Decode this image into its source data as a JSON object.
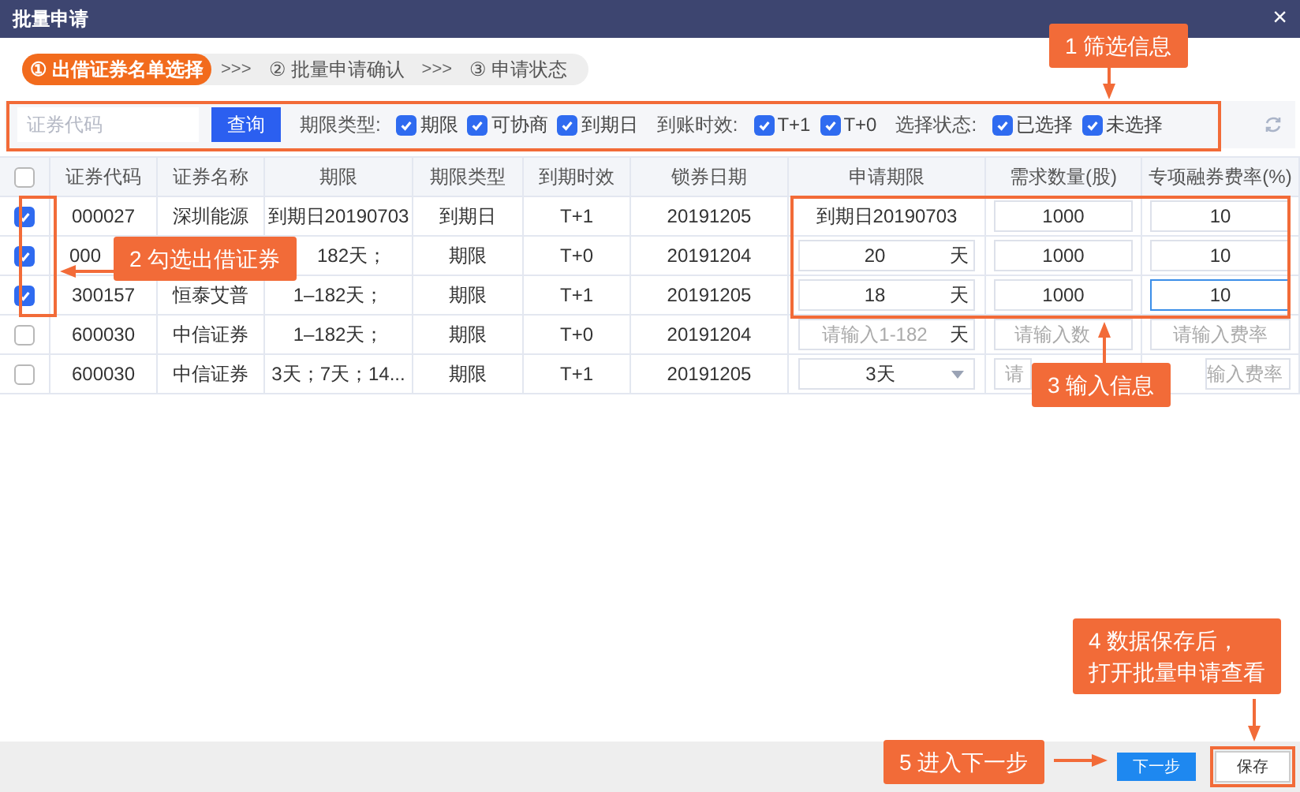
{
  "window": {
    "title": "批量申请",
    "close": "×"
  },
  "steps": [
    {
      "number": "①",
      "label": "出借证券名单选择",
      "selected": true
    },
    {
      "number": "②",
      "label": "批量申请确认",
      "selected": false
    },
    {
      "number": "③",
      "label": "申请状态",
      "selected": false
    }
  ],
  "step_separator": ">>>",
  "filter": {
    "placeholder": "证券代码",
    "query_button": "查询",
    "groups": [
      {
        "label": "期限类型:",
        "options": [
          {
            "label": "期限",
            "checked": true
          },
          {
            "label": "可协商",
            "checked": true
          },
          {
            "label": "到期日",
            "checked": true
          }
        ]
      },
      {
        "label": "到账时效:",
        "options": [
          {
            "label": "T+1",
            "checked": true
          },
          {
            "label": "T+0",
            "checked": true
          }
        ]
      },
      {
        "label": "选择状态:",
        "options": [
          {
            "label": "已选择",
            "checked": true
          },
          {
            "label": "未选择",
            "checked": true
          }
        ]
      }
    ]
  },
  "table": {
    "select_all": false,
    "columns": [
      "证券代码",
      "证券名称",
      "期限",
      "期限类型",
      "到期时效",
      "锁券日期",
      "申请期限",
      "需求数量(股)",
      "专项融券费率(%)"
    ],
    "rows": [
      {
        "checked": true,
        "code": "000027",
        "name": "深圳能源",
        "period": "到期日20190703",
        "period_type": "到期日",
        "effect": "T+1",
        "lock_date": "20191205",
        "apply": {
          "kind": "text",
          "value": "到期日20190703"
        },
        "quantity": {
          "value": "1000"
        },
        "rate": {
          "value": "10",
          "focused": false
        }
      },
      {
        "checked": true,
        "code": "000",
        "period": "182天；",
        "period_type": "期限",
        "effect": "T+0",
        "lock_date": "20191204",
        "apply": {
          "kind": "days",
          "value": "20",
          "unit": "天"
        },
        "quantity": {
          "value": "1000"
        },
        "rate": {
          "value": "10",
          "focused": false
        }
      },
      {
        "checked": true,
        "code": "300157",
        "name": "恒泰艾普",
        "period": "1–182天；",
        "period_type": "期限",
        "effect": "T+1",
        "lock_date": "20191205",
        "apply": {
          "kind": "days",
          "value": "18",
          "unit": "天"
        },
        "quantity": {
          "value": "1000"
        },
        "rate": {
          "value": "10",
          "focused": true
        }
      },
      {
        "checked": false,
        "code": "600030",
        "name": "中信证券",
        "period": "1–182天；",
        "period_type": "期限",
        "effect": "T+0",
        "lock_date": "20191204",
        "apply": {
          "kind": "days",
          "placeholder": "请输入1-182",
          "unit": "天"
        },
        "quantity": {
          "placeholder": "请输入数"
        },
        "rate": {
          "placeholder": "请输入费率",
          "focused": false
        }
      },
      {
        "checked": false,
        "code": "600030",
        "name": "中信证券",
        "period": "3天；7天；14...",
        "period_type": "期限",
        "effect": "T+1",
        "lock_date": "20191205",
        "apply": {
          "kind": "select",
          "value": "3天"
        },
        "quantity": {
          "placeholder": "请"
        },
        "rate": {
          "placeholder": "输入费率",
          "focused": false
        }
      }
    ]
  },
  "footer": {
    "next_button": "下一步",
    "save_button": "保存"
  },
  "callouts": [
    {
      "text": "1 筛选信息"
    },
    {
      "text": "2 勾选出借证券"
    },
    {
      "text": "3 输入信息"
    },
    {
      "lines": [
        "4 数据保存后，",
        "打开批量申请查看"
      ]
    },
    {
      "text": "5 进入下一步"
    }
  ]
}
